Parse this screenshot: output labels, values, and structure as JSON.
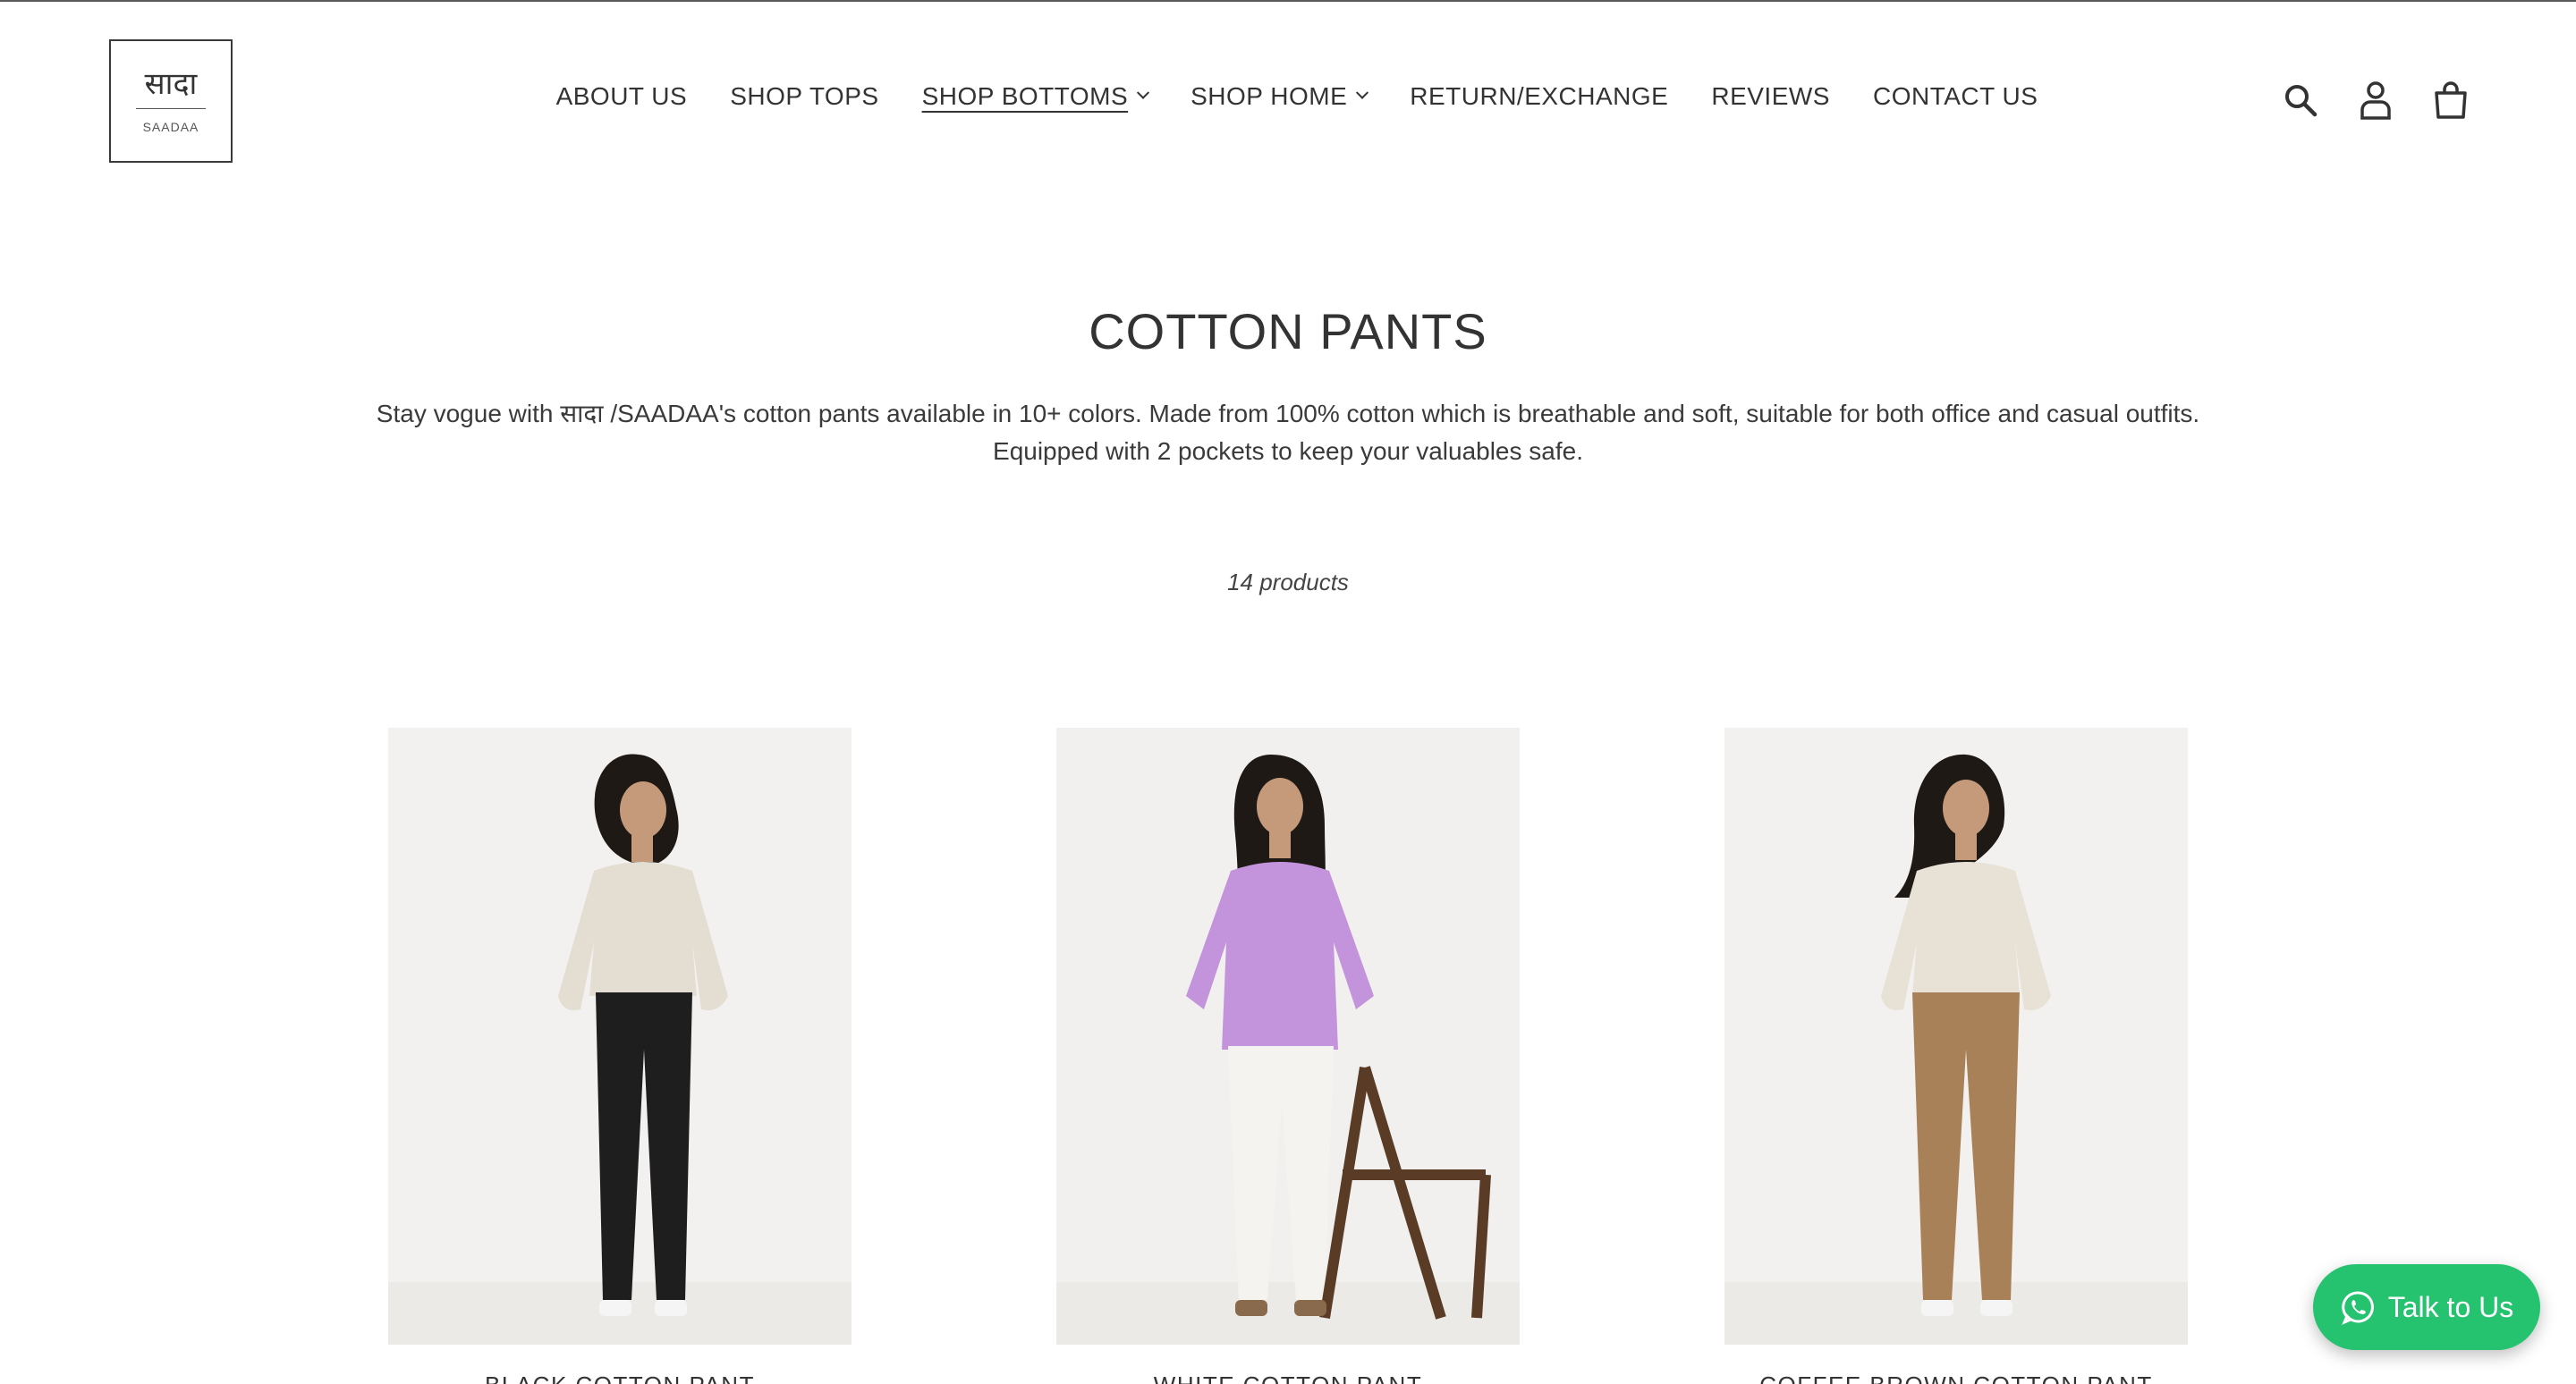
{
  "header": {
    "logo_hindi": "सादा",
    "logo_latin": "SAADAA",
    "nav": [
      {
        "label": "ABOUT US",
        "dropdown": false,
        "active": false
      },
      {
        "label": "SHOP TOPS",
        "dropdown": false,
        "active": false
      },
      {
        "label": "SHOP BOTTOMS",
        "dropdown": true,
        "active": true
      },
      {
        "label": "SHOP HOME",
        "dropdown": true,
        "active": false
      },
      {
        "label": "RETURN/EXCHANGE",
        "dropdown": false,
        "active": false
      },
      {
        "label": "REVIEWS",
        "dropdown": false,
        "active": false
      },
      {
        "label": "CONTACT US",
        "dropdown": false,
        "active": false
      }
    ],
    "icons": [
      "search-icon",
      "account-icon",
      "cart-icon"
    ]
  },
  "collection": {
    "title": "COTTON PANTS",
    "description_line1": "Stay vogue with सादा /SAADAA's cotton pants available in 10+ colors. Made from 100% cotton which is breathable and soft, suitable for both office and casual outfits.",
    "description_line2": "Equipped with 2 pockets to keep your valuables safe.",
    "count": "14 products"
  },
  "products": [
    {
      "title": "BLACK COTTON PANT",
      "top_color": "#e4ddd2",
      "pant_color": "#1e1e1e",
      "bg": "#f2f1ef"
    },
    {
      "title": "WHITE COTTON PANT",
      "top_color": "#c394dc",
      "pant_color": "#f4f3ef",
      "bg": "#f1f0ee"
    },
    {
      "title": "COFFEE BROWN COTTON PANT",
      "top_color": "#e8e1d6",
      "pant_color": "#a88159",
      "bg": "#f2f1ef"
    }
  ],
  "chat": {
    "label": "Talk to Us",
    "color": "#25c270"
  }
}
